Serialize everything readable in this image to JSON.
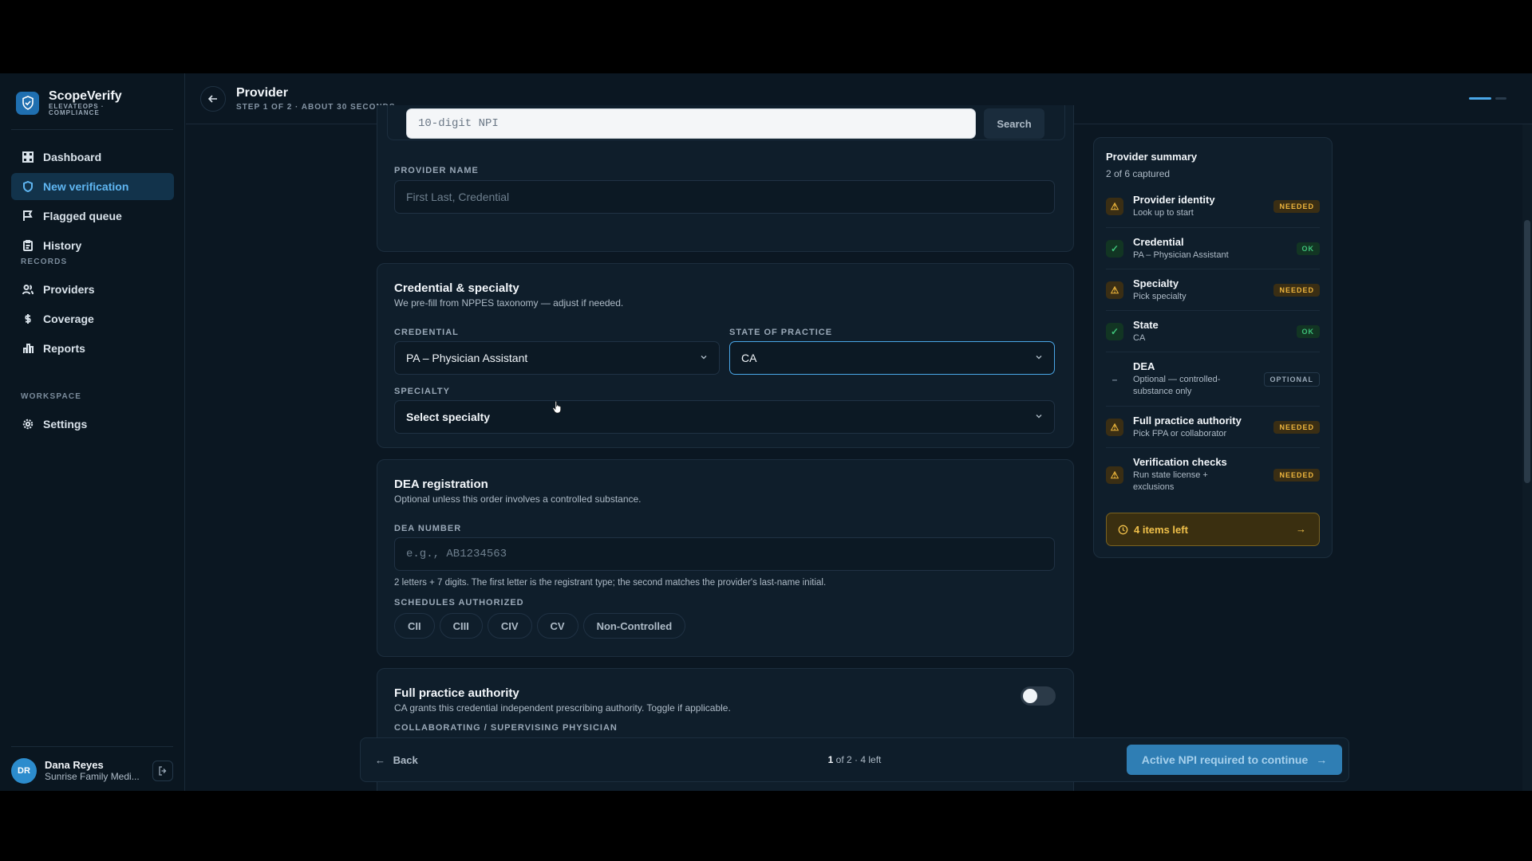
{
  "brand": {
    "name": "ScopeVerify",
    "sub": "ELEVATEOPS · COMPLIANCE"
  },
  "sidebar": {
    "main": [
      {
        "label": "Dashboard",
        "icon": "grid-icon"
      },
      {
        "label": "New verification",
        "icon": "shield-icon",
        "active": true
      },
      {
        "label": "Flagged queue",
        "icon": "flag-icon"
      },
      {
        "label": "History",
        "icon": "clipboard-icon"
      }
    ],
    "records_label": "RECORDS",
    "records": [
      {
        "label": "Providers",
        "icon": "users-icon"
      },
      {
        "label": "Coverage",
        "icon": "dollar-icon"
      },
      {
        "label": "Reports",
        "icon": "bar-chart-icon"
      }
    ],
    "workspace_label": "WORKSPACE",
    "workspace": [
      {
        "label": "Settings",
        "icon": "gear-icon"
      }
    ]
  },
  "user": {
    "initials": "DR",
    "name": "Dana Reyes",
    "org": "Sunrise Family Medi..."
  },
  "topbar": {
    "title": "Provider",
    "subtitle": "STEP 1 OF 2 · ABOUT 30 SECONDS"
  },
  "npi": {
    "placeholder": "10-digit NPI",
    "search_label": "Search"
  },
  "provider_name": {
    "label": "PROVIDER NAME",
    "placeholder": "First Last, Credential"
  },
  "credential_card": {
    "title": "Credential & specialty",
    "desc": "We pre-fill from NPPES taxonomy — adjust if needed.",
    "credential_label": "CREDENTIAL",
    "credential_value": "PA – Physician Assistant",
    "state_label": "STATE OF PRACTICE",
    "state_value": "CA",
    "specialty_label": "SPECIALTY",
    "specialty_value": "Select specialty"
  },
  "dea_card": {
    "title": "DEA registration",
    "desc": "Optional unless this order involves a controlled substance.",
    "number_label": "DEA NUMBER",
    "number_placeholder": "e.g., AB1234563",
    "hint": "2 letters + 7 digits. The first letter is the registrant type; the second matches the provider's last-name initial.",
    "schedules_label": "SCHEDULES AUTHORIZED",
    "schedules": [
      "CII",
      "CIII",
      "CIV",
      "CV",
      "Non-Controlled"
    ]
  },
  "fpa_card": {
    "title": "Full practice authority",
    "desc": "CA grants this credential independent prescribing authority. Toggle if applicable.",
    "collab_label": "COLLABORATING / SUPERVISING PHYSICIAN",
    "toggle_on": false
  },
  "summary": {
    "title": "Provider summary",
    "subtitle": "2 of 6 captured",
    "items": [
      {
        "name": "Provider identity",
        "detail": "Look up to start",
        "status": "NEEDED",
        "kind": "needed"
      },
      {
        "name": "Credential",
        "detail": "PA – Physician Assistant",
        "status": "OK",
        "kind": "ok"
      },
      {
        "name": "Specialty",
        "detail": "Pick specialty",
        "status": "NEEDED",
        "kind": "needed"
      },
      {
        "name": "State",
        "detail": "CA",
        "status": "OK",
        "kind": "ok"
      },
      {
        "name": "DEA",
        "detail": "Optional — controlled-substance only",
        "status": "OPTIONAL",
        "kind": "optional"
      },
      {
        "name": "Full practice authority",
        "detail": "Pick FPA or collaborator",
        "status": "NEEDED",
        "kind": "needed"
      },
      {
        "name": "Verification checks",
        "detail": "Run state license + exclusions",
        "status": "NEEDED",
        "kind": "needed"
      }
    ],
    "items_left": "4 items left"
  },
  "footer": {
    "back_label": "Back",
    "page_current": "1",
    "page_rest": " of 2 · 4 left",
    "cta_label": "Active NPI required to continue"
  },
  "colors": {
    "accent": "#4aa7e8",
    "warning": "#f0b63d",
    "ok": "#3ec27a",
    "background": "#0b1722"
  }
}
